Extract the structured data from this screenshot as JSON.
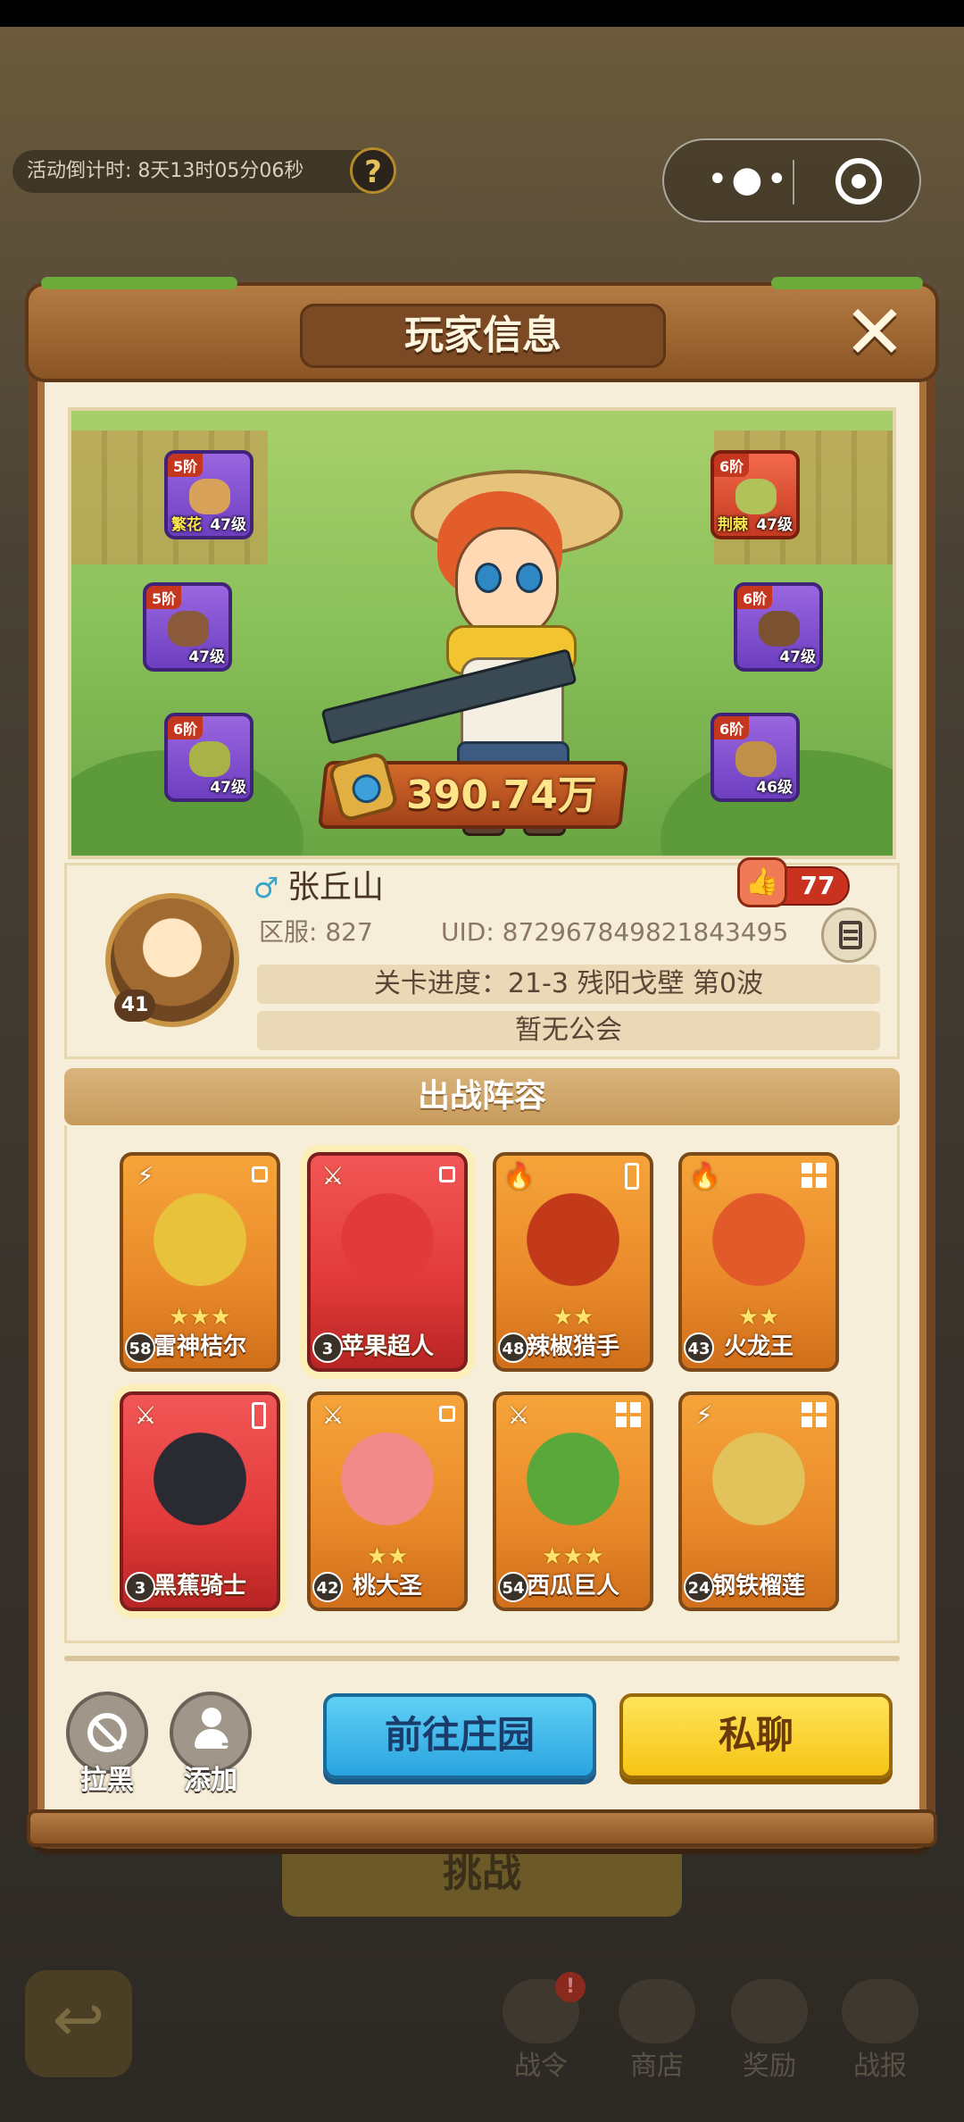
{
  "top": {
    "countdown": "活动倒计时: 8天13时05分06秒",
    "help_symbol": "?",
    "capsule_more": "•●•"
  },
  "panel": {
    "title": "玩家信息",
    "close_symbol": "✕"
  },
  "hero": {
    "power": "390.74万",
    "equipment": [
      {
        "slot": "hat",
        "tier": "5阶",
        "name": "繁花",
        "level": "47级",
        "rarity": "purple",
        "icon": "straw-hat-icon",
        "color": "#d8a25a"
      },
      {
        "slot": "armor",
        "tier": "6阶",
        "name": "荆棘",
        "level": "47级",
        "rarity": "red",
        "icon": "vest-icon",
        "color": "#b2c25a"
      },
      {
        "slot": "gloves",
        "tier": "5阶",
        "name": "",
        "level": "47级",
        "rarity": "purple",
        "icon": "glove-icon",
        "color": "#8a5a3a"
      },
      {
        "slot": "belt",
        "tier": "6阶",
        "name": "",
        "level": "47级",
        "rarity": "purple",
        "icon": "belt-icon",
        "color": "#7a5232"
      },
      {
        "slot": "pants",
        "tier": "6阶",
        "name": "",
        "level": "47级",
        "rarity": "purple",
        "icon": "shorts-icon",
        "color": "#a8b246"
      },
      {
        "slot": "boots",
        "tier": "6阶",
        "name": "",
        "level": "46级",
        "rarity": "purple",
        "icon": "boots-icon",
        "color": "#c09048"
      }
    ]
  },
  "player": {
    "avatar_level": "41",
    "gender_symbol": "♂",
    "name": "张丘山",
    "likes": "77",
    "like_symbol": "👍",
    "server": "区服: 827",
    "uid": "UID: 8729678498218434​95",
    "progress": "关卡进度：21-3  残阳戈壁 第0波",
    "guild": "暂无公会"
  },
  "lineup": {
    "title": "出战阵容",
    "cards": [
      {
        "name": "雷神桔尔",
        "level": "58",
        "stars": "★★★",
        "role": "⚡",
        "slot": "single",
        "color": "orange",
        "glow": false,
        "art": "#e8c23a"
      },
      {
        "name": "苹果超人",
        "level": "3",
        "stars": "",
        "role": "⚔",
        "slot": "single",
        "color": "red",
        "glow": true,
        "art": "#e23a3a"
      },
      {
        "name": "辣椒猎手",
        "level": "48",
        "stars": "★★",
        "role": "🔥",
        "slot": "double",
        "color": "orange",
        "glow": false,
        "art": "#c23a1a"
      },
      {
        "name": "火龙王",
        "level": "43",
        "stars": "★★",
        "role": "🔥",
        "slot": "quad",
        "color": "orange",
        "glow": false,
        "art": "#e25a2a"
      },
      {
        "name": "黑蕉骑士",
        "level": "3",
        "stars": "",
        "role": "⚔",
        "slot": "double",
        "color": "red",
        "glow": true,
        "art": "#2a2a32"
      },
      {
        "name": "桃大圣",
        "level": "42",
        "stars": "★★",
        "role": "⚔",
        "slot": "single",
        "color": "orange",
        "glow": false,
        "art": "#f28a8a"
      },
      {
        "name": "西瓜巨人",
        "level": "54",
        "stars": "★★★",
        "role": "⚔",
        "slot": "quad",
        "color": "orange",
        "glow": false,
        "art": "#5aa83a"
      },
      {
        "name": "钢铁榴莲",
        "level": "24",
        "stars": "",
        "role": "⚡",
        "slot": "quad",
        "color": "orange",
        "glow": false,
        "art": "#e2c25a"
      }
    ]
  },
  "actions": {
    "block": "拉黑",
    "add": "添加",
    "visit": "前往庄园",
    "chat": "私聊"
  },
  "background": {
    "challenge": "挑战",
    "nav": [
      "战令",
      "商店",
      "奖励",
      "战报"
    ],
    "nav_badge": "!"
  }
}
